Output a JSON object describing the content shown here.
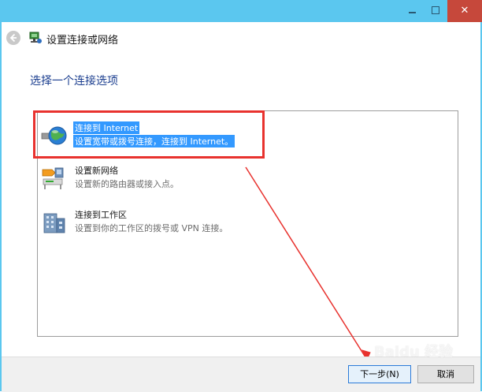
{
  "header": {
    "title": "设置连接或网络"
  },
  "section_title": "选择一个连接选项",
  "options": [
    {
      "name": "连接到 Internet",
      "desc": "设置宽带或拨号连接，连接到 Internet。"
    },
    {
      "name": "设置新网络",
      "desc": "设置新的路由器或接入点。"
    },
    {
      "name": "连接到工作区",
      "desc": "设置到你的工作区的拨号或 VPN 连接。"
    }
  ],
  "footer": {
    "next_label": "下一步(N)",
    "cancel_label": "取消"
  },
  "window": {
    "close_glyph": "✕"
  },
  "watermark": "Baidu 经验",
  "colors": {
    "titlebar": "#5bc7ef",
    "selection": "#3399ff",
    "annotation": "#e8322e",
    "heading": "#1b3e8f"
  }
}
